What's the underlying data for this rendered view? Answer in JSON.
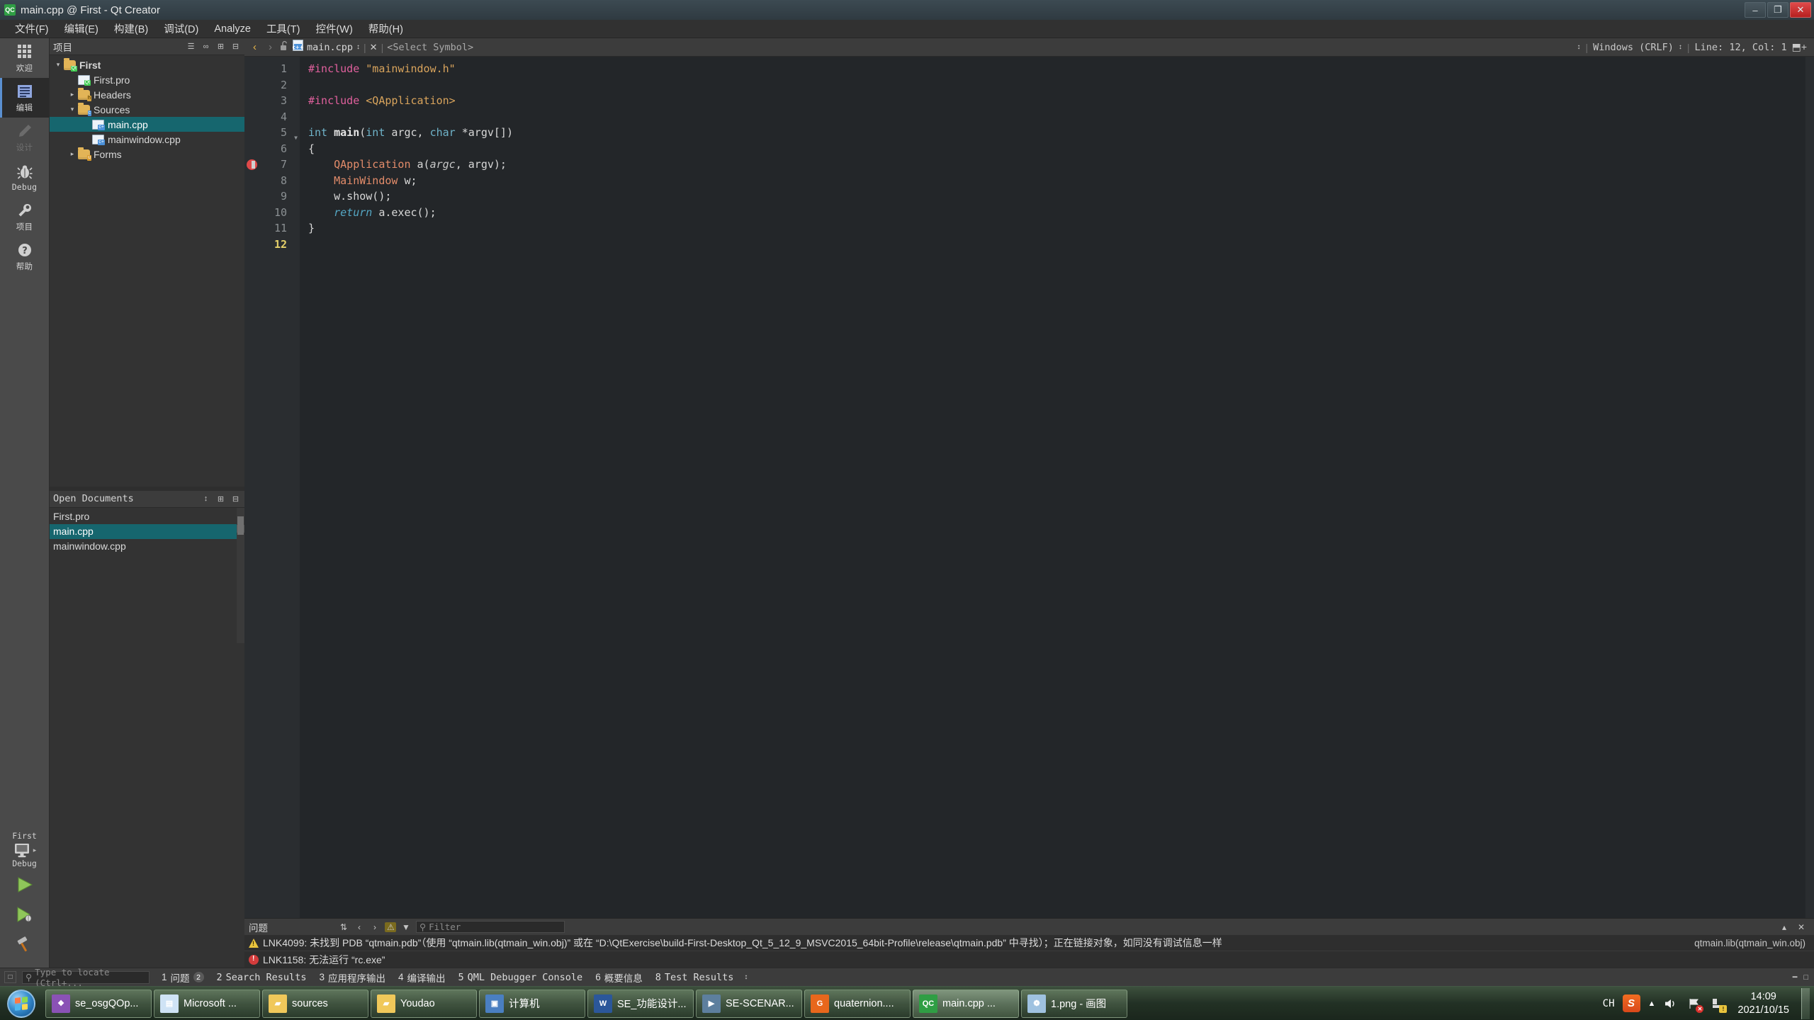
{
  "window": {
    "title": "main.cpp @ First - Qt Creator",
    "app_icon": "QC",
    "minimize": "–",
    "maximize": "❐",
    "close": "✕"
  },
  "menubar": {
    "items": [
      {
        "label": "文件(F)",
        "accel": "F"
      },
      {
        "label": "编辑(E)",
        "accel": "E"
      },
      {
        "label": "构建(B)",
        "accel": "B"
      },
      {
        "label": "调试(D)",
        "accel": "D"
      },
      {
        "label": "Analyze",
        "accel": "A"
      },
      {
        "label": "工具(T)",
        "accel": "T"
      },
      {
        "label": "控件(W)",
        "accel": "W"
      },
      {
        "label": "帮助(H)",
        "accel": "H"
      }
    ]
  },
  "modebar": {
    "items": [
      {
        "label": "欢迎",
        "icon": "grid-icon",
        "state": "normal"
      },
      {
        "label": "编辑",
        "icon": "document-lines-icon",
        "state": "active"
      },
      {
        "label": "设计",
        "icon": "pencil-icon",
        "state": "disabled"
      },
      {
        "label": "Debug",
        "icon": "bug-icon",
        "state": "normal"
      },
      {
        "label": "项目",
        "icon": "wrench-icon",
        "state": "normal"
      },
      {
        "label": "帮助",
        "icon": "question-mark-icon",
        "state": "normal"
      }
    ],
    "kit": {
      "project": "First",
      "build_config": "Debug",
      "run_label": "Run",
      "debug_label": "Start Debugging",
      "build_label": "Build"
    }
  },
  "project_pane": {
    "title": "项目",
    "header_buttons": [
      "filter-icon",
      "sync-icon",
      "split-icon",
      "close-pane-icon"
    ],
    "tree": [
      {
        "indent": 0,
        "twisty": "▾",
        "icon": "folder-qt",
        "label": "First",
        "selected": false,
        "bold": true
      },
      {
        "indent": 1,
        "twisty": "",
        "icon": "file-pro",
        "label": "First.pro",
        "selected": false
      },
      {
        "indent": 1,
        "twisty": "▸",
        "icon": "folder-h",
        "label": "Headers",
        "selected": false
      },
      {
        "indent": 1,
        "twisty": "▾",
        "icon": "folder-cpp",
        "label": "Sources",
        "selected": false
      },
      {
        "indent": 2,
        "twisty": "",
        "icon": "file-cpp",
        "label": "main.cpp",
        "selected": true
      },
      {
        "indent": 2,
        "twisty": "",
        "icon": "file-cpp",
        "label": "mainwindow.cpp",
        "selected": false
      },
      {
        "indent": 1,
        "twisty": "▸",
        "icon": "folder-ui",
        "label": "Forms",
        "selected": false
      }
    ]
  },
  "open_documents": {
    "title": "Open Documents",
    "header_buttons": [
      "sort-icon",
      "split-icon",
      "close-pane-icon"
    ],
    "items": [
      {
        "label": "First.pro",
        "selected": false
      },
      {
        "label": "main.cpp",
        "selected": true
      },
      {
        "label": "mainwindow.cpp",
        "selected": false
      }
    ]
  },
  "editor_toolbar": {
    "back": "‹",
    "forward": "›",
    "lock_icon": "unlock-icon",
    "file_icon": "cpp-file-icon",
    "filename": "main.cpp",
    "dropdown": "↕",
    "close": "✕",
    "symbol_selector": "<Select Symbol>",
    "line_ending": "Windows (CRLF)",
    "cursor_position": "Line: 12, Col: 1",
    "split_icon": "⬒+"
  },
  "editor": {
    "current_line": 12,
    "breakpoint_line": 7,
    "fold_line": 5,
    "lines": [
      {
        "n": 1,
        "tokens": [
          {
            "t": "#include ",
            "c": "k-pre"
          },
          {
            "t": "\"mainwindow.h\"",
            "c": "k-str"
          }
        ]
      },
      {
        "n": 2,
        "tokens": []
      },
      {
        "n": 3,
        "tokens": [
          {
            "t": "#include ",
            "c": "k-pre"
          },
          {
            "t": "<QApplication>",
            "c": "k-str"
          }
        ]
      },
      {
        "n": 4,
        "tokens": []
      },
      {
        "n": 5,
        "tokens": [
          {
            "t": "int ",
            "c": "k-kw"
          },
          {
            "t": "main",
            "c": "k-fn"
          },
          {
            "t": "(",
            "c": "k-plain"
          },
          {
            "t": "int",
            "c": "k-kw"
          },
          {
            "t": " argc, ",
            "c": "k-plain"
          },
          {
            "t": "char",
            "c": "k-kw"
          },
          {
            "t": " *argv[])",
            "c": "k-plain"
          }
        ]
      },
      {
        "n": 6,
        "tokens": [
          {
            "t": "{",
            "c": "k-plain"
          }
        ]
      },
      {
        "n": 7,
        "tokens": [
          {
            "t": "    ",
            "c": "k-plain"
          },
          {
            "t": "QApplication",
            "c": "k-cls"
          },
          {
            "t": " a(",
            "c": "k-plain"
          },
          {
            "t": "argc",
            "c": "k-param"
          },
          {
            "t": ", argv);",
            "c": "k-plain"
          }
        ]
      },
      {
        "n": 8,
        "tokens": [
          {
            "t": "    ",
            "c": "k-plain"
          },
          {
            "t": "MainWindow",
            "c": "k-cls"
          },
          {
            "t": " w;",
            "c": "k-plain"
          }
        ]
      },
      {
        "n": 9,
        "tokens": [
          {
            "t": "    w.show();",
            "c": "k-plain"
          }
        ]
      },
      {
        "n": 10,
        "tokens": [
          {
            "t": "    ",
            "c": "k-plain"
          },
          {
            "t": "return",
            "c": "k-ret"
          },
          {
            "t": " a.exec();",
            "c": "k-plain"
          }
        ]
      },
      {
        "n": 11,
        "tokens": [
          {
            "t": "}",
            "c": "k-plain"
          }
        ]
      },
      {
        "n": 12,
        "tokens": []
      }
    ]
  },
  "issues_pane": {
    "title": "问题",
    "sort_icon": "sort-icon",
    "prev": "‹",
    "next": "›",
    "warning_filter_icon": "warning-filter-icon",
    "funnel_icon": "funnel-icon",
    "search_icon": "search-icon",
    "filter_placeholder": "Filter",
    "collapse_icon": "▴",
    "close_icon": "✕",
    "rows": [
      {
        "severity": "warning",
        "text": "LNK4099: 未找到 PDB “qtmain.pdb”（使用 “qtmain.lib(qtmain_win.obj)” 或在 “D:\\QtExercise\\build-First-Desktop_Qt_5_12_9_MSVC2015_64bit-Profile\\release\\qtmain.pdb” 中寻找）；正在链接对象，如同没有调试信息一样",
        "right": "qtmain.lib(qtmain_win.obj)"
      },
      {
        "severity": "error",
        "text": "LNK1158: 无法运行 “rc.exe”",
        "right": ""
      }
    ]
  },
  "statusbar": {
    "collapse_icon": "□",
    "locator_icon": "search-icon",
    "locator_placeholder": "Type to locate (Ctrl+...",
    "tabs": [
      {
        "num": "1",
        "label": "问题",
        "count": "2",
        "cjk": true
      },
      {
        "num": "2",
        "label": "Search Results",
        "count": "",
        "cjk": false
      },
      {
        "num": "3",
        "label": "应用程序输出",
        "count": "",
        "cjk": true
      },
      {
        "num": "4",
        "label": "编译输出",
        "count": "",
        "cjk": true
      },
      {
        "num": "5",
        "label": "QML Debugger Console",
        "count": "",
        "cjk": false
      },
      {
        "num": "6",
        "label": "概要信息",
        "count": "",
        "cjk": true
      },
      {
        "num": "8",
        "label": "Test Results",
        "count": "",
        "cjk": false
      }
    ],
    "spin": "↕",
    "right_buttons": [
      "minimize-output-icon",
      "maximize-output-icon"
    ]
  },
  "taskbar": {
    "start_label": "Start",
    "tasks": [
      {
        "label": "se_osgQOp...",
        "icon": "visual-studio-icon",
        "color": "#8a52b5",
        "glyph": "❖",
        "active": false
      },
      {
        "label": "Microsoft ...",
        "icon": "window-icon",
        "color": "#cfe3f5",
        "glyph": "▤",
        "active": false
      },
      {
        "label": "sources",
        "icon": "folder-icon",
        "color": "#f0c85a",
        "glyph": "▰",
        "active": false
      },
      {
        "label": "Youdao",
        "icon": "folder-icon",
        "color": "#f0c85a",
        "glyph": "▰",
        "active": false
      },
      {
        "label": "计算机",
        "icon": "computer-icon",
        "color": "#4a7fc1",
        "glyph": "▣",
        "active": false
      },
      {
        "label": "SE_功能设计...",
        "icon": "word-icon",
        "color": "#2b579a",
        "glyph": "W",
        "active": false
      },
      {
        "label": "SE-SCENAR...",
        "icon": "video-icon",
        "color": "#5d7f9e",
        "glyph": "▶",
        "active": false
      },
      {
        "label": "quaternion....",
        "icon": "pdf-icon",
        "color": "#e8671c",
        "glyph": "G",
        "active": false
      },
      {
        "label": "main.cpp ...",
        "icon": "qtcreator-icon",
        "color": "#2f9e44",
        "glyph": "QC",
        "active": true
      },
      {
        "label": "1.png - 画图",
        "icon": "paint-icon",
        "color": "#9fc2e0",
        "glyph": "❁",
        "active": false
      }
    ],
    "tray": {
      "ime": "CH",
      "sogou": "S",
      "show_hidden": "▲",
      "volume": "🔊",
      "network": "⚑",
      "action_center": "⚑",
      "time": "14:09",
      "date": "2021/10/15"
    }
  }
}
